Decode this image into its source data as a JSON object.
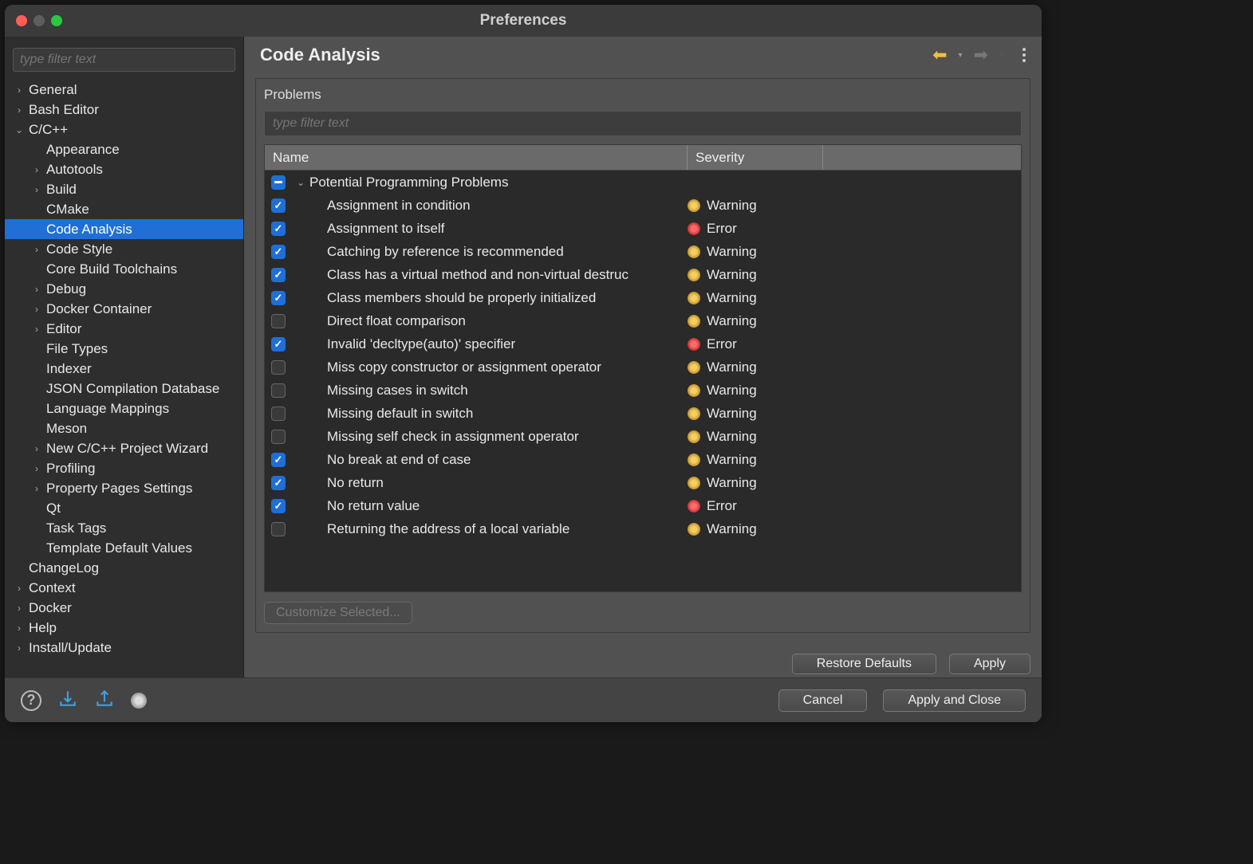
{
  "window": {
    "title": "Preferences"
  },
  "sidebar": {
    "filter_placeholder": "type filter text",
    "items": [
      {
        "label": "General",
        "depth": 0,
        "expand": "closed"
      },
      {
        "label": "Bash Editor",
        "depth": 0,
        "expand": "closed"
      },
      {
        "label": "C/C++",
        "depth": 0,
        "expand": "open"
      },
      {
        "label": "Appearance",
        "depth": 1,
        "expand": "none"
      },
      {
        "label": "Autotools",
        "depth": 1,
        "expand": "closed"
      },
      {
        "label": "Build",
        "depth": 1,
        "expand": "closed"
      },
      {
        "label": "CMake",
        "depth": 1,
        "expand": "none"
      },
      {
        "label": "Code Analysis",
        "depth": 1,
        "expand": "none",
        "selected": true
      },
      {
        "label": "Code Style",
        "depth": 1,
        "expand": "closed"
      },
      {
        "label": "Core Build Toolchains",
        "depth": 1,
        "expand": "none"
      },
      {
        "label": "Debug",
        "depth": 1,
        "expand": "closed"
      },
      {
        "label": "Docker Container",
        "depth": 1,
        "expand": "closed"
      },
      {
        "label": "Editor",
        "depth": 1,
        "expand": "closed"
      },
      {
        "label": "File Types",
        "depth": 1,
        "expand": "none"
      },
      {
        "label": "Indexer",
        "depth": 1,
        "expand": "none"
      },
      {
        "label": "JSON Compilation Database",
        "depth": 1,
        "expand": "none"
      },
      {
        "label": "Language Mappings",
        "depth": 1,
        "expand": "none"
      },
      {
        "label": "Meson",
        "depth": 1,
        "expand": "none"
      },
      {
        "label": "New C/C++ Project Wizard",
        "depth": 1,
        "expand": "closed"
      },
      {
        "label": "Profiling",
        "depth": 1,
        "expand": "closed"
      },
      {
        "label": "Property Pages Settings",
        "depth": 1,
        "expand": "closed"
      },
      {
        "label": "Qt",
        "depth": 1,
        "expand": "none"
      },
      {
        "label": "Task Tags",
        "depth": 1,
        "expand": "none"
      },
      {
        "label": "Template Default Values",
        "depth": 1,
        "expand": "none"
      },
      {
        "label": "ChangeLog",
        "depth": 0,
        "expand": "none"
      },
      {
        "label": "Context",
        "depth": 0,
        "expand": "closed"
      },
      {
        "label": "Docker",
        "depth": 0,
        "expand": "closed"
      },
      {
        "label": "Help",
        "depth": 0,
        "expand": "closed"
      },
      {
        "label": "Install/Update",
        "depth": 0,
        "expand": "closed"
      }
    ]
  },
  "main": {
    "title": "Code Analysis",
    "section_label": "Problems",
    "filter_placeholder": "type filter text",
    "columns": {
      "name": "Name",
      "severity": "Severity"
    },
    "rows": [
      {
        "type": "group",
        "check": "mixed",
        "expand": "open",
        "name": "Potential Programming Problems"
      },
      {
        "type": "item",
        "check": "checked",
        "name": "Assignment in condition",
        "severity": "Warning"
      },
      {
        "type": "item",
        "check": "checked",
        "name": "Assignment to itself",
        "severity": "Error"
      },
      {
        "type": "item",
        "check": "checked",
        "name": "Catching by reference is recommended",
        "severity": "Warning"
      },
      {
        "type": "item",
        "check": "checked",
        "name": "Class has a virtual method and non-virtual destruc",
        "severity": "Warning"
      },
      {
        "type": "item",
        "check": "checked",
        "name": "Class members should be properly initialized",
        "severity": "Warning"
      },
      {
        "type": "item",
        "check": "unchecked",
        "name": "Direct float comparison",
        "severity": "Warning"
      },
      {
        "type": "item",
        "check": "checked",
        "name": "Invalid 'decltype(auto)' specifier",
        "severity": "Error"
      },
      {
        "type": "item",
        "check": "unchecked",
        "name": "Miss copy constructor or assignment operator",
        "severity": "Warning"
      },
      {
        "type": "item",
        "check": "unchecked",
        "name": "Missing cases in switch",
        "severity": "Warning"
      },
      {
        "type": "item",
        "check": "unchecked",
        "name": "Missing default in switch",
        "severity": "Warning"
      },
      {
        "type": "item",
        "check": "unchecked",
        "name": "Missing self check in assignment operator",
        "severity": "Warning"
      },
      {
        "type": "item",
        "check": "checked",
        "name": "No break at end of case",
        "severity": "Warning"
      },
      {
        "type": "item",
        "check": "checked",
        "name": "No return",
        "severity": "Warning"
      },
      {
        "type": "item",
        "check": "checked",
        "name": "No return value",
        "severity": "Error"
      },
      {
        "type": "item",
        "check": "unchecked",
        "name": "Returning the address of a local variable",
        "severity": "Warning"
      }
    ],
    "customize_label": "Customize Selected...",
    "restore_label": "Restore Defaults",
    "apply_label": "Apply"
  },
  "footer": {
    "cancel_label": "Cancel",
    "apply_close_label": "Apply and Close"
  }
}
